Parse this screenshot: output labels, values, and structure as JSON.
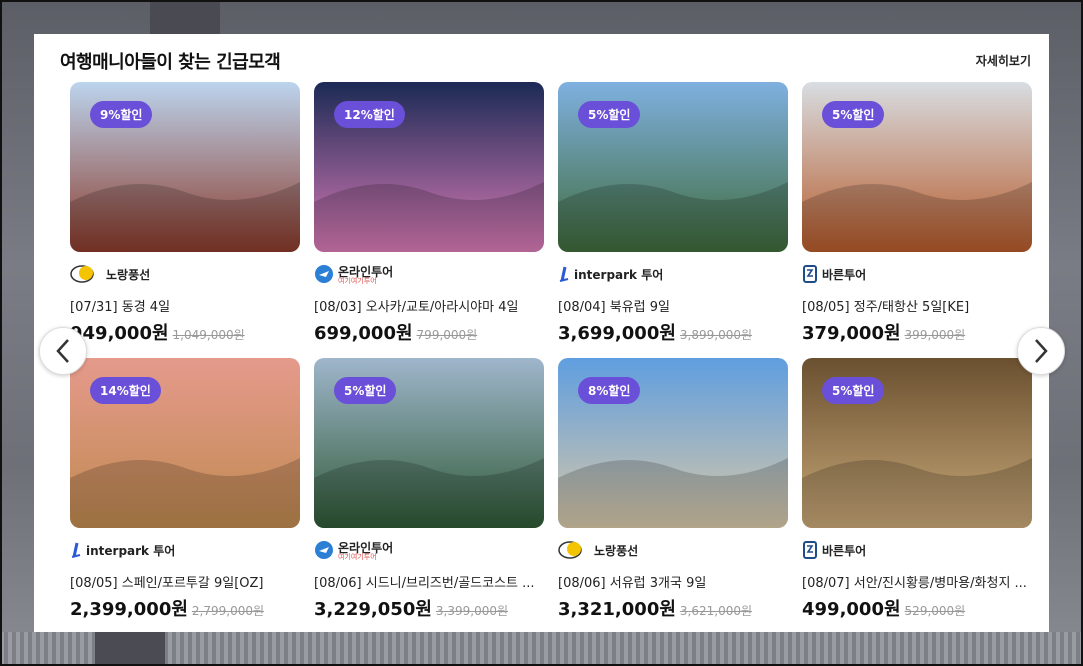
{
  "section": {
    "title": "여행매니아들이 찾는 긴급모객",
    "more_label": "자세히보기"
  },
  "cards": [
    {
      "badge": "9%할인",
      "brand": "노랑풍선",
      "brand_icon": "yellow-balloon-icon",
      "name": "[07/31] 동경 4일",
      "price": "949,000원",
      "original": "1,049,000원",
      "colors": [
        "#bcd4ee",
        "#8a3a2a"
      ]
    },
    {
      "badge": "12%할인",
      "brand": "온라인투어",
      "brand_sub": "여기여기투어",
      "brand_icon": "plane-icon",
      "name": "[08/03] 오사카/교토/아라시야마 4일",
      "price": "699,000원",
      "original": "799,000원",
      "colors": [
        "#1b2a55",
        "#d97bb6"
      ]
    },
    {
      "badge": "5%할인",
      "brand": "interpark 투어",
      "brand_icon": "interpark-icon",
      "name": "[08/04] 북유럽 9일",
      "price": "3,699,000원",
      "original": "3,899,000원",
      "colors": [
        "#7fb0e0",
        "#3f6b3a"
      ]
    },
    {
      "badge": "5%할인",
      "brand": "바른투어",
      "brand_icon": "barun-icon",
      "name": "[08/05] 정주/태항산 5일[KE]",
      "price": "379,000원",
      "original": "399,000원",
      "colors": [
        "#d8dde2",
        "#b65a2a"
      ]
    },
    {
      "badge": "14%할인",
      "brand": "interpark 투어",
      "brand_icon": "interpark-icon",
      "name": "[08/05] 스페인/포르투갈 9일[OZ]",
      "price": "2,399,000원",
      "original": "2,799,000원",
      "colors": [
        "#e59a8c",
        "#c08a50"
      ]
    },
    {
      "badge": "5%할인",
      "brand": "온라인투어",
      "brand_sub": "여기여기투어",
      "brand_icon": "plane-icon",
      "name": "[08/06] 시드니/브리즈번/골드코스트 ...",
      "price": "3,229,050원",
      "original": "3,399,000원",
      "colors": [
        "#9fb6cc",
        "#2f5a36"
      ]
    },
    {
      "badge": "8%할인",
      "brand": "노랑풍선",
      "brand_icon": "yellow-balloon-icon",
      "name": "[08/06] 서유럽 3개국 9일",
      "price": "3,321,000원",
      "original": "3,621,000원",
      "colors": [
        "#5f9ee0",
        "#d8c8a8"
      ]
    },
    {
      "badge": "5%할인",
      "brand": "바른투어",
      "brand_icon": "barun-icon",
      "name": "[08/07] 서안/진시황릉/병마용/화청지 ...",
      "price": "499,000원",
      "original": "529,000원",
      "colors": [
        "#6a5030",
        "#c8a878"
      ]
    }
  ],
  "nav": {
    "prev_icon": "chevron-left-icon",
    "next_icon": "chevron-right-icon"
  }
}
